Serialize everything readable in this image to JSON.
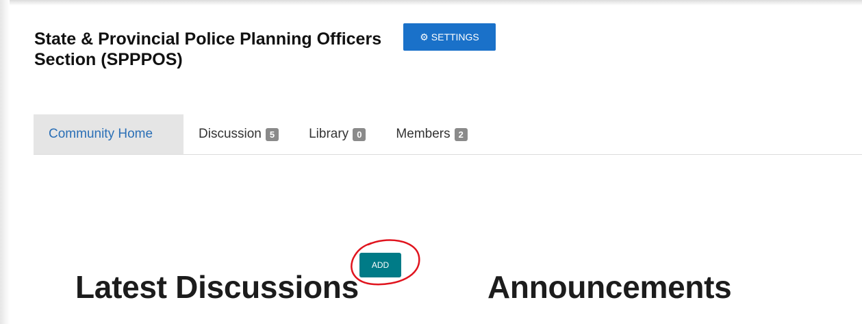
{
  "header": {
    "title": "State & Provincial Police Planning Officers Section (SPPPOS)",
    "settings_label": "SETTINGS",
    "settings_icon": "gear-icon"
  },
  "tabs": [
    {
      "label": "Community Home",
      "active": true
    },
    {
      "label": "Discussion",
      "count": "5"
    },
    {
      "label": "Library",
      "count": "0"
    },
    {
      "label": "Members",
      "count": "2"
    }
  ],
  "sections": {
    "discussions_heading": "Latest Discussions",
    "add_label": "ADD",
    "announcements_heading": "Announcements"
  },
  "colors": {
    "primary_blue": "#1a71c9",
    "teal": "#007b87",
    "annotation_red": "#e0141e",
    "active_tab_bg": "#e5e5e5",
    "badge_gray": "#8a8a8a"
  }
}
